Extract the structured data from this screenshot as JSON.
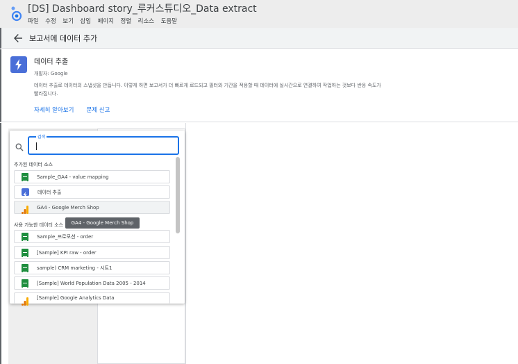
{
  "app": {
    "title": "[DS] Dashboard story_루커스튜디오_Data extract",
    "menu": [
      "파일",
      "수정",
      "보기",
      "삽입",
      "페이지",
      "정렬",
      "리소스",
      "도움말"
    ]
  },
  "panel": {
    "title": "보고서에 데이터 추가"
  },
  "connector": {
    "name": "데이터 추출",
    "developer": "개발자: Google",
    "description": "데이터 추출로 데이터의 스냅샷을 만듭니다. 이렇게 하면 보고서가 더 빠르게 로드되고 필터와 기간을 적용할 때 데이터에 실시간으로 연결하여 작업하는 것보다 반응 속도가 빨라집니다.",
    "learn_more": "자세히 알아보기",
    "report_issue": "문제 신고"
  },
  "dropdown": {
    "search_label": "검색",
    "search_value": "",
    "added_section": "추가된 데이터 소스",
    "added_items": [
      {
        "label": "Sample_GA4 - value mapping",
        "icon": "sheets-icon"
      },
      {
        "label": "데이터 추출",
        "icon": "extract-icon"
      },
      {
        "label": "GA4 - Google Merch Shop",
        "icon": "analytics-icon"
      }
    ],
    "available_section": "사용 가능한 데이터 소스",
    "available_items": [
      {
        "label": "Sample_프로모션 - order",
        "icon": "sheets-icon"
      },
      {
        "label": "[Sample] KPI raw - order",
        "icon": "sheets-icon"
      },
      {
        "label": "sample) CRM marketing - 시트1",
        "icon": "sheets-icon"
      },
      {
        "label": "[Sample] World Population Data 2005 - 2014",
        "icon": "sheets-icon"
      },
      {
        "label": "[Sample] Google Analytics Data",
        "icon": "analytics-icon"
      }
    ],
    "tooltip": "GA4 - Google Merch Shop"
  },
  "colors": {
    "accent": "#1a73e8",
    "sheets": "#1e8e3e",
    "extract": "#4a6fd8",
    "analytics_dark": "#e37400",
    "analytics_light": "#f9ab00"
  }
}
